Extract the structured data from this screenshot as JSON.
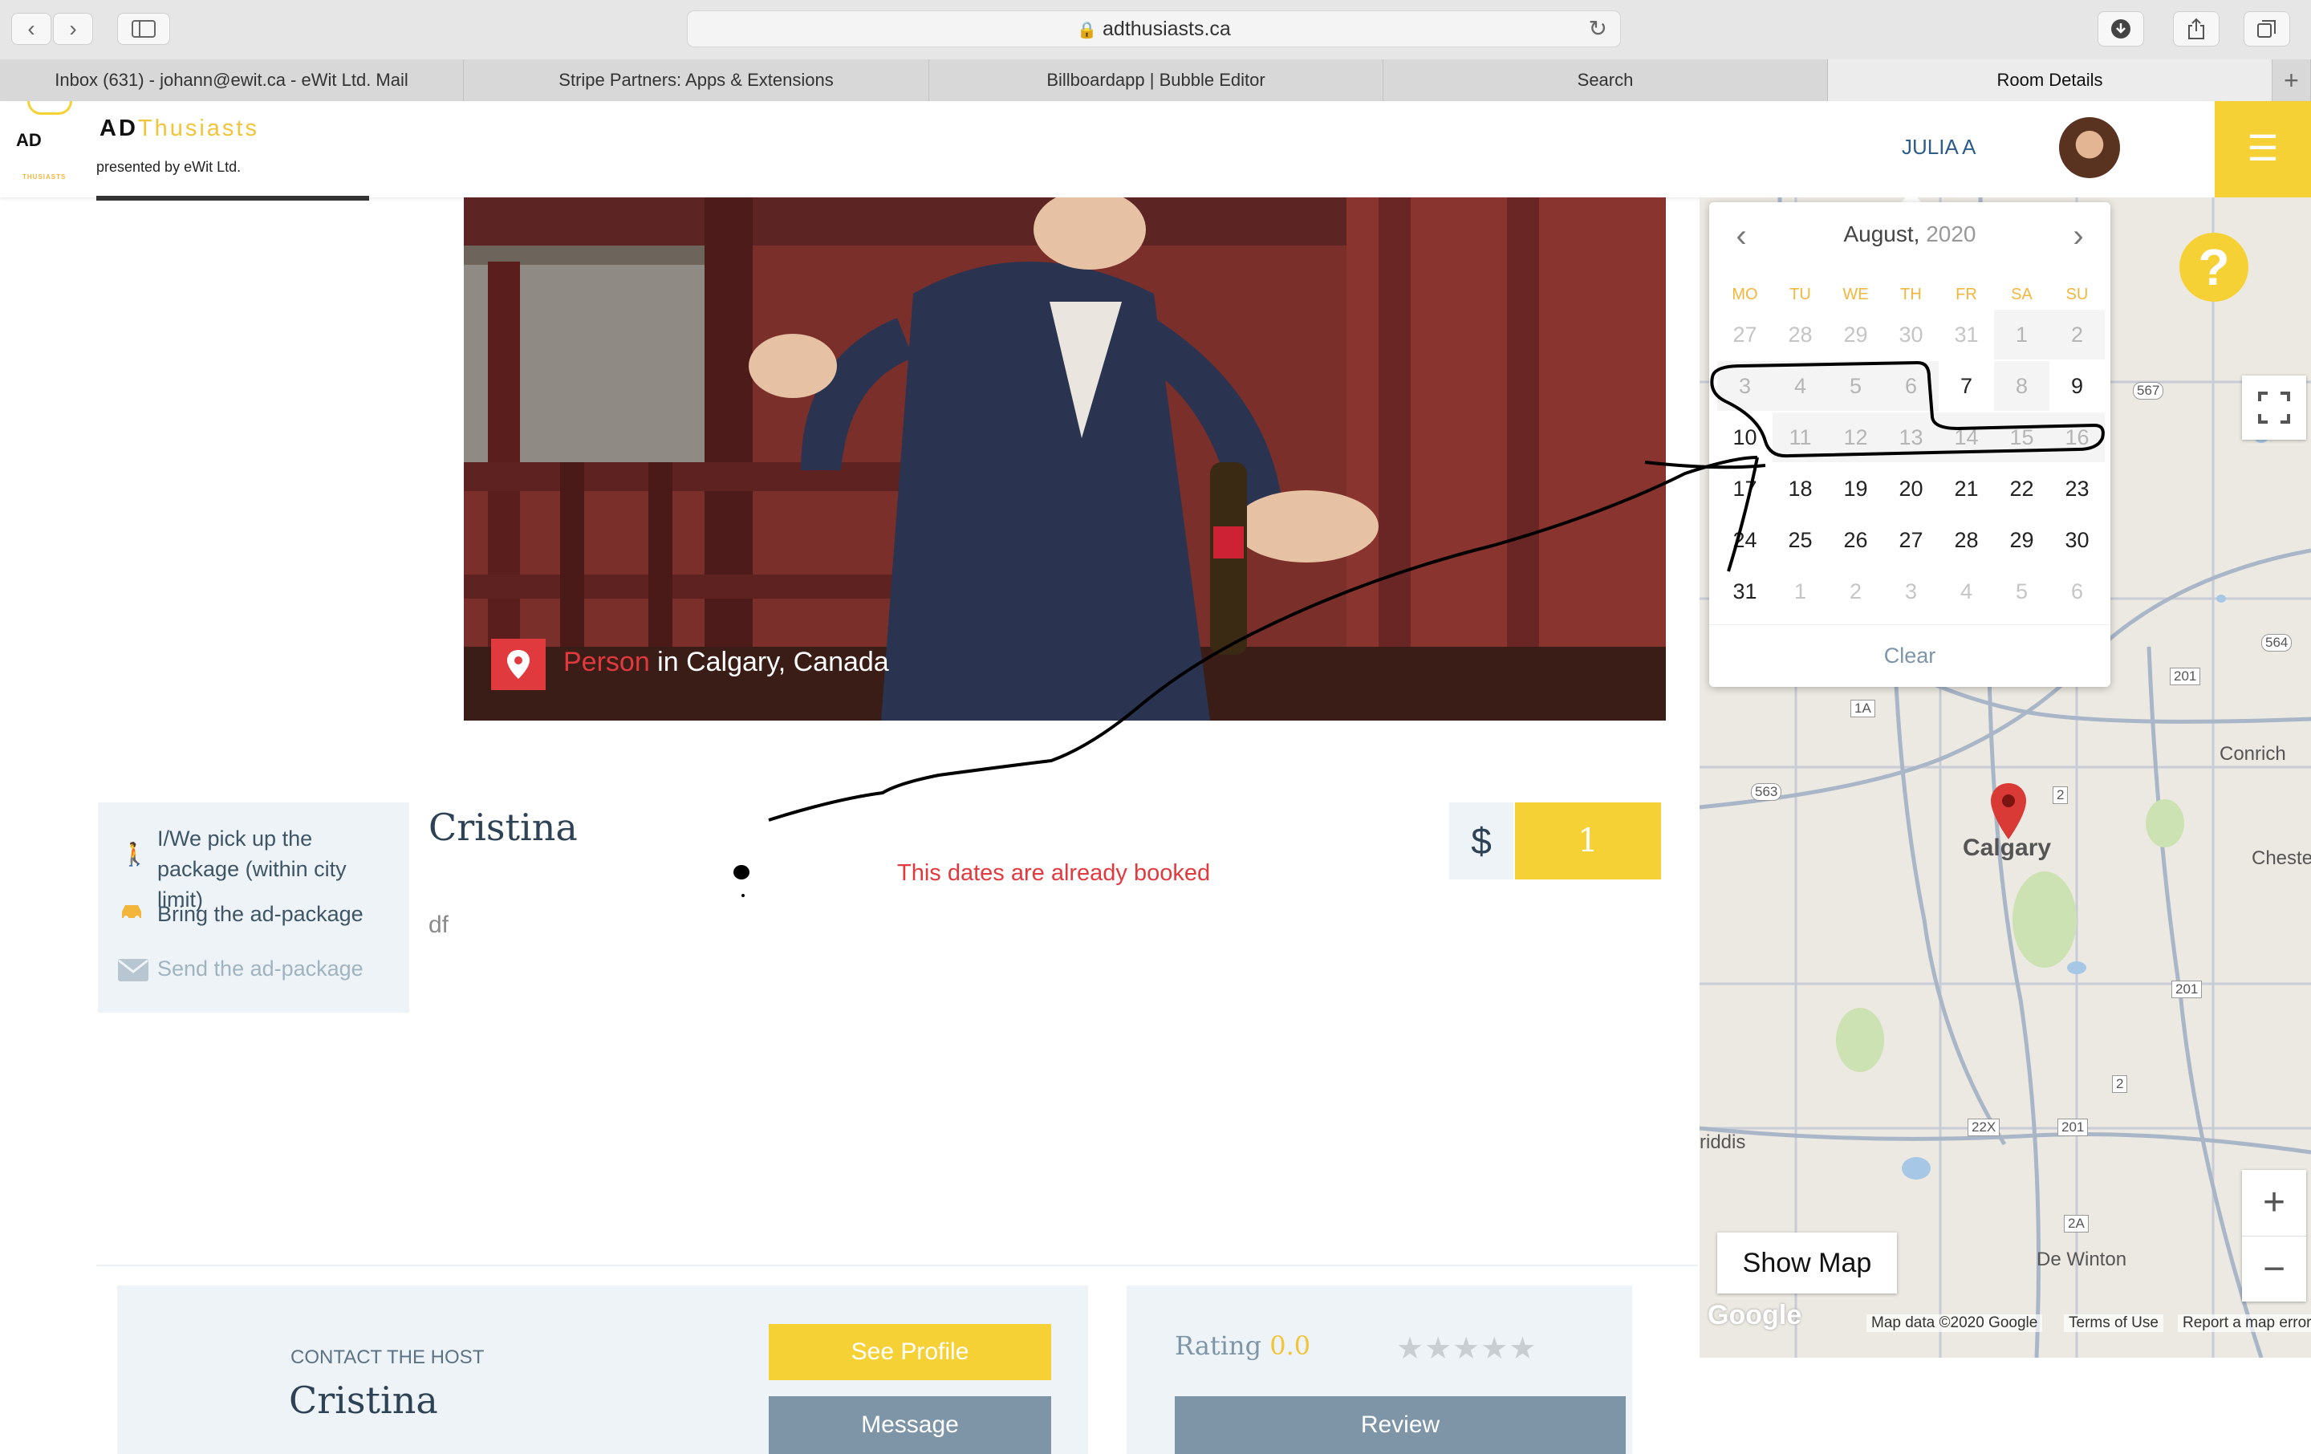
{
  "browser": {
    "url": "adthusiasts.ca",
    "tabs": [
      {
        "label": "Inbox (631) - johann@ewit.ca - eWit Ltd. Mail"
      },
      {
        "label": "Stripe Partners: Apps & Extensions"
      },
      {
        "label": "Billboardapp | Bubble Editor"
      },
      {
        "label": "Search"
      },
      {
        "label": "Room Details"
      }
    ],
    "new_tab": "+"
  },
  "header": {
    "logo_mark": "AD",
    "logo_sub": "THUSIASTS",
    "brand_ad": "AD",
    "brand_rest": "Thusiasts",
    "tagline": "presented by eWit Ltd.",
    "user_name": "JULIA A"
  },
  "calendar": {
    "month": "August,",
    "year": "2020",
    "weekdays": [
      "MO",
      "TU",
      "WE",
      "TH",
      "FR",
      "SA",
      "SU"
    ],
    "weeks": [
      [
        {
          "d": "27",
          "s": "muted"
        },
        {
          "d": "28",
          "s": "muted"
        },
        {
          "d": "29",
          "s": "muted"
        },
        {
          "d": "30",
          "s": "muted"
        },
        {
          "d": "31",
          "s": "muted"
        },
        {
          "d": "1",
          "s": "booked"
        },
        {
          "d": "2",
          "s": "booked"
        }
      ],
      [
        {
          "d": "3",
          "s": "booked"
        },
        {
          "d": "4",
          "s": "booked"
        },
        {
          "d": "5",
          "s": "booked"
        },
        {
          "d": "6",
          "s": "booked"
        },
        {
          "d": "7",
          "s": "avail"
        },
        {
          "d": "8",
          "s": "booked"
        },
        {
          "d": "9",
          "s": "avail"
        }
      ],
      [
        {
          "d": "10",
          "s": "avail"
        },
        {
          "d": "11",
          "s": "booked"
        },
        {
          "d": "12",
          "s": "booked"
        },
        {
          "d": "13",
          "s": "booked"
        },
        {
          "d": "14",
          "s": "booked"
        },
        {
          "d": "15",
          "s": "booked"
        },
        {
          "d": "16",
          "s": "booked"
        }
      ],
      [
        {
          "d": "17",
          "s": "avail"
        },
        {
          "d": "18",
          "s": "avail"
        },
        {
          "d": "19",
          "s": "avail"
        },
        {
          "d": "20",
          "s": "avail"
        },
        {
          "d": "21",
          "s": "avail"
        },
        {
          "d": "22",
          "s": "avail"
        },
        {
          "d": "23",
          "s": "avail"
        }
      ],
      [
        {
          "d": "24",
          "s": "avail"
        },
        {
          "d": "25",
          "s": "avail"
        },
        {
          "d": "26",
          "s": "avail"
        },
        {
          "d": "27",
          "s": "avail"
        },
        {
          "d": "28",
          "s": "avail"
        },
        {
          "d": "29",
          "s": "avail"
        },
        {
          "d": "30",
          "s": "avail"
        }
      ],
      [
        {
          "d": "31",
          "s": "avail"
        },
        {
          "d": "1",
          "s": "muted"
        },
        {
          "d": "2",
          "s": "muted"
        },
        {
          "d": "3",
          "s": "muted"
        },
        {
          "d": "4",
          "s": "muted"
        },
        {
          "d": "5",
          "s": "muted"
        },
        {
          "d": "6",
          "s": "muted"
        }
      ]
    ],
    "clear_label": "Clear"
  },
  "listing": {
    "category": "Person",
    "location": " in Calgary, Canada",
    "host_name": "Cristina",
    "description": "df",
    "booked_warning": "This dates are already booked",
    "currency": "$",
    "price": "1",
    "options": [
      {
        "label": "I/We pick up the package (within city limit)",
        "icon": "walking-person-icon",
        "enabled": true
      },
      {
        "label": "Bring the ad-package",
        "icon": "car-icon",
        "enabled": true
      },
      {
        "label": "Send the ad-package",
        "icon": "envelope-icon",
        "enabled": false
      }
    ]
  },
  "contact": {
    "heading": "CONTACT THE HOST",
    "name": "Cristina",
    "see_profile": "See Profile",
    "message": "Message"
  },
  "rating": {
    "label": "Rating",
    "value": "0.0",
    "stars_filled": 0,
    "stars_total": 5,
    "review": "Review"
  },
  "map": {
    "city": "Calgary",
    "labels": {
      "conrich": "Conrich",
      "chestermere": "Chesterm",
      "de_winton": "De Winton",
      "priddis": "riddis"
    },
    "shields": {
      "s567": "567",
      "s564": "564",
      "s201a": "201",
      "s201b": "201",
      "s201c": "201",
      "s1a": "1A",
      "s563": "563",
      "s2a": "2",
      "s2b": "2",
      "s22x": "22X",
      "s2a2": "2A"
    },
    "show_map": "Show Map",
    "zoom_in": "+",
    "zoom_out": "−",
    "google": "Google",
    "map_data": "Map data ©2020 Google",
    "terms": "Terms of Use",
    "report": "Report a map error"
  },
  "colors": {
    "accent": "#f6d136",
    "red": "#e0393e",
    "slate": "#7d95a6",
    "panel": "#eef3f7"
  }
}
